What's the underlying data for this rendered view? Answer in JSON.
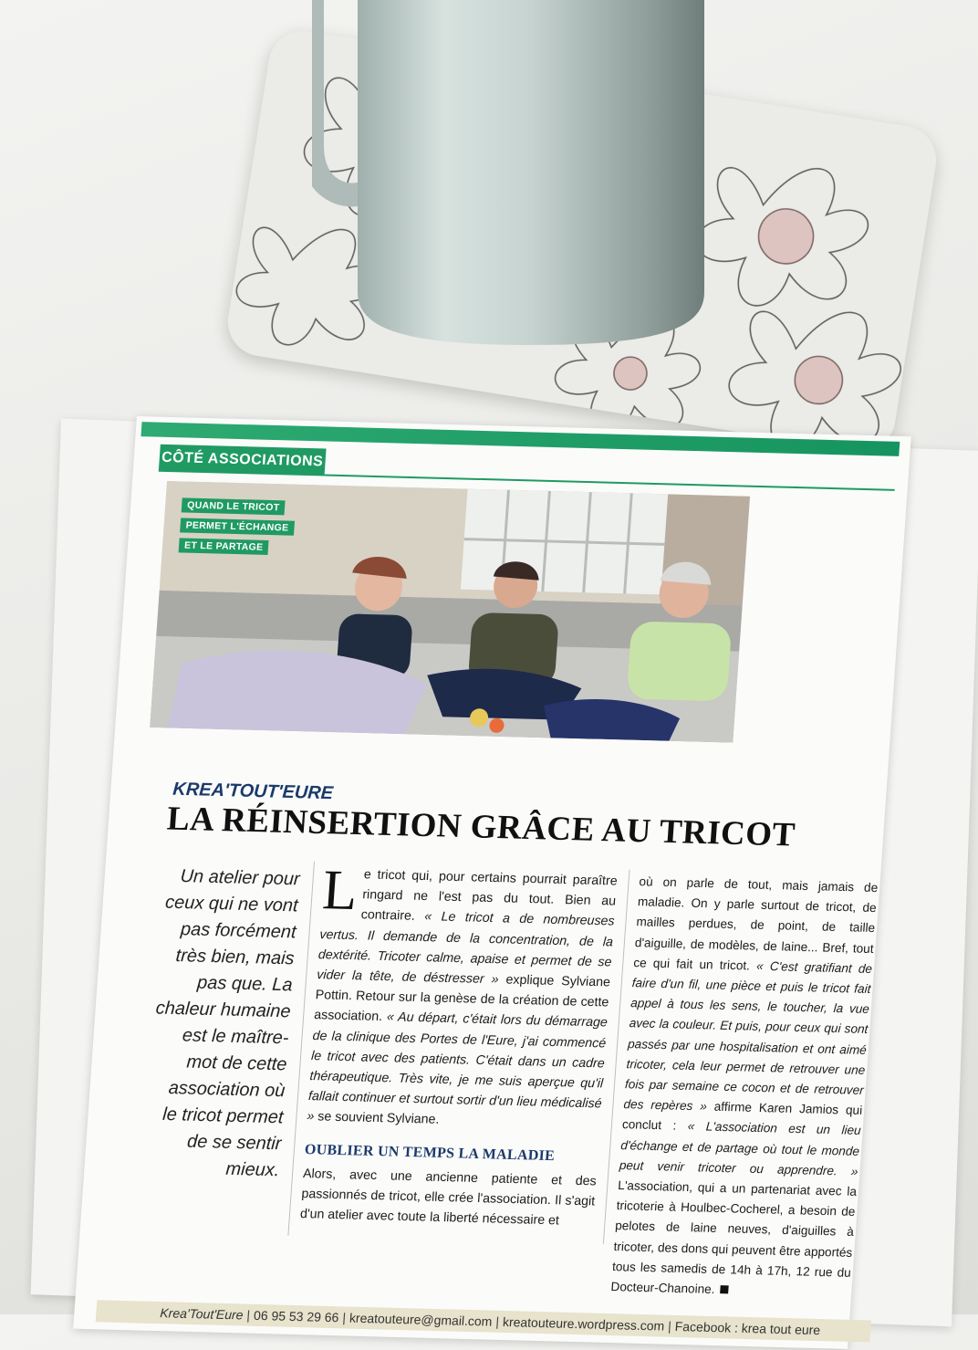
{
  "magazine": {
    "section_label": "CÔTÉ ASSOCIATIONS",
    "photo_caption_lines": [
      "QUAND LE TRICOT",
      "PERMET L'ÉCHANGE",
      "ET LE PARTAGE"
    ],
    "kicker": "KREA'TOUT'EURE",
    "headline": "LA RÉINSERTION GRÂCE AU TRICOT",
    "intro": "Un atelier pour ceux qui ne vont pas forcément très bien, mais pas que. La chaleur humaine est le maître-mot de cette association où le tricot permet de se sentir mieux.",
    "col1": {
      "dropcap": "L",
      "p1_a": "e tricot qui, pour certains pourrait paraître ringard ne l'est pas du tout. Bien au contraire. ",
      "p1_q": "« Le tricot a de nombreuses vertus. Il demande de la concentration, de la dextérité. Tricoter calme, apaise et permet de se vider la tête, de déstresser »",
      "p1_b": " explique Sylviane Pottin. Retour sur la genèse de la création de cette association. ",
      "p1_q2": "« Au départ, c'était lors du démarrage de la clinique des Portes de l'Eure, j'ai commencé le tricot avec des patients. C'était dans un cadre thérapeutique. Très vite, je me suis aperçue qu'il fallait continuer et surtout sortir d'un lieu médicalisé »",
      "p1_c": " se souvient Sylviane.",
      "subhead": "OUBLIER UN TEMPS LA MALADIE",
      "p2": "Alors, avec une ancienne patiente et des passionnés de tricot, elle crée l'association. Il s'agit d'un atelier avec toute la liberté nécessaire et"
    },
    "col2": {
      "p1": "où on parle de tout, mais jamais de maladie. On y parle surtout de tricot, de mailles perdues, de point, de taille d'aiguille, de modèles, de laine... Bref, tout ce qui fait un tricot. ",
      "q1": "« C'est gratifiant de faire d'un fil, une pièce et puis le tricot fait appel à tous les sens, le toucher, la vue avec la couleur. Et puis, pour ceux qui sont passés par une hospitalisation et ont aimé tricoter, cela leur permet de retrouver une fois par semaine ce cocon et de retrouver des repères »",
      "p2": " affirme Karen Jamios qui conclut : ",
      "q2": "« L'association est un lieu d'échange et de partage où tout le monde peut venir tricoter ou apprendre. »",
      "p3": " L'association, qui a un partenariat avec la tricoterie à Houlbec-Cocherel, a besoin de pelotes de laine neuves, d'aiguilles à tricoter, des dons qui peuvent être apportés tous les samedis de 14h à 17h, 12 rue du Docteur-Chanoine."
    },
    "footer": {
      "name": "Krea'Tout'Eure",
      "phone": "06 95 53 29 66",
      "email": "kreatouteure@gmail.com",
      "website": "kreatouteure.wordpress.com",
      "facebook": "Facebook : krea tout eure"
    }
  },
  "colors": {
    "accent_green": "#1f9a63",
    "headline_blue": "#1b3a6b",
    "footer_band": "#e7e3cc"
  },
  "icons": [
    "mug",
    "floral-tray"
  ]
}
